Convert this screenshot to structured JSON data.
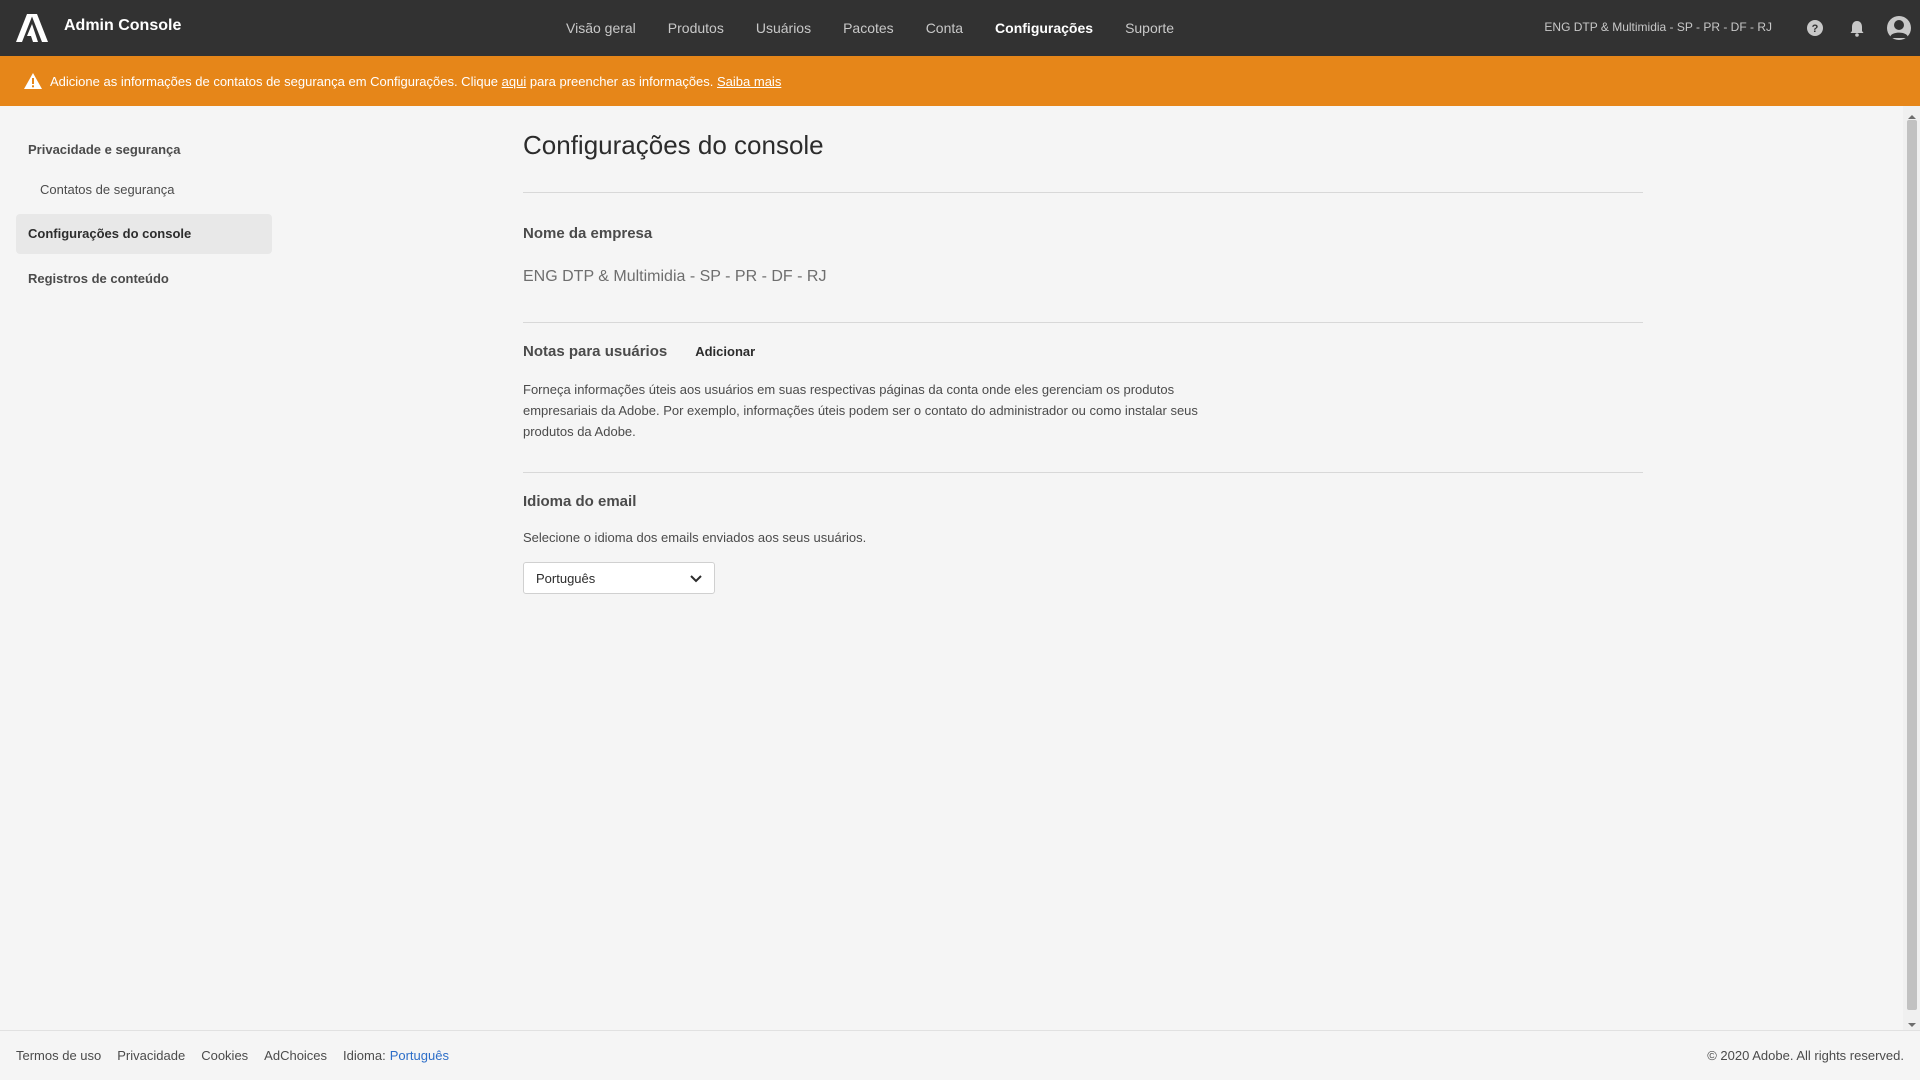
{
  "app": {
    "title": "Admin Console"
  },
  "nav": {
    "items": [
      {
        "label": "Visão geral"
      },
      {
        "label": "Produtos"
      },
      {
        "label": "Usuários"
      },
      {
        "label": "Pacotes"
      },
      {
        "label": "Conta"
      },
      {
        "label": "Configurações"
      },
      {
        "label": "Suporte"
      }
    ],
    "active": "Configurações"
  },
  "header": {
    "org_name": "ENG DTP & Multimidia - SP - PR - DF - RJ",
    "icons": [
      "help-icon",
      "bell-icon",
      "user-avatar-icon"
    ]
  },
  "banner": {
    "text_before": "Adicione as informações de contatos de segurança em Configurações. Clique ",
    "link_here": "aqui",
    "text_after": " para preencher as informações. ",
    "link_learn": "Saiba mais",
    "icon": "warning-icon",
    "color": "#e68619"
  },
  "sidebar": {
    "items": [
      {
        "label": "Privacidade e segurança"
      },
      {
        "label": "Contatos de segurança"
      },
      {
        "label": "Configurações do console"
      },
      {
        "label": "Registros de conteúdo"
      }
    ],
    "active": "Configurações do console"
  },
  "main": {
    "title": "Configurações do console",
    "company": {
      "label": "Nome da empresa",
      "value": "ENG DTP & Multimidia - SP - PR - DF - RJ"
    },
    "notes": {
      "label": "Notas para usuários",
      "add_label": "Adicionar",
      "description": "Forneça informações úteis aos usuários em suas respectivas páginas da conta onde eles gerenciam os produtos empresariais da Adobe. Por exemplo, informações úteis podem ser o contato do administrador ou como instalar seus produtos da Adobe."
    },
    "email_language": {
      "label": "Idioma do email",
      "description": "Selecione o idioma dos emails enviados aos seus usuários.",
      "selected": "Português"
    }
  },
  "footer": {
    "links": [
      {
        "label": "Termos de uso"
      },
      {
        "label": "Privacidade"
      },
      {
        "label": "Cookies"
      },
      {
        "label": "AdChoices"
      }
    ],
    "language_label": "Idioma:",
    "language_value": "Português",
    "copyright": "© 2020 Adobe. All rights reserved."
  }
}
